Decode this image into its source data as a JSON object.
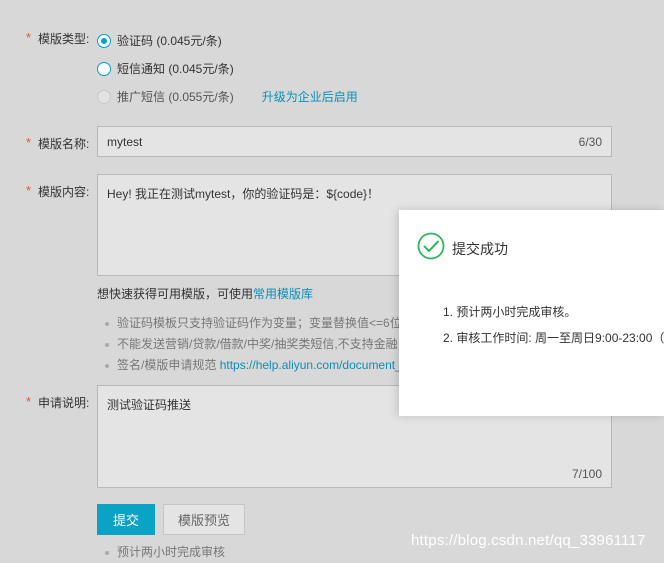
{
  "form": {
    "template_type": {
      "required_mark": "*",
      "label": "模版类型:",
      "options": [
        {
          "label": "验证码 (0.045元/条)",
          "checked": true,
          "disabled": false
        },
        {
          "label": "短信通知 (0.045元/条)",
          "checked": false,
          "disabled": false
        },
        {
          "label": "推广短信 (0.055元/条)",
          "checked": false,
          "disabled": true
        }
      ],
      "upgrade_link": "升级为企业后启用"
    },
    "template_name": {
      "required_mark": "*",
      "label": "模版名称:",
      "value": "mytest",
      "counter": "6/30"
    },
    "template_content": {
      "required_mark": "*",
      "label": "模版内容:",
      "value": "Hey! 我正在测试mytest，你的验证码是：${code}！",
      "hint_prefix": "想快速获得可用模版，可使用",
      "hint_link": "常用模版库",
      "rules": [
        "验证码模板只支持验证码作为变量；变量替换值<=6位",
        "不能发送营销/贷款/借款/中奖/抽奖类短信,不支持金融",
        "签名/模版申请规范"
      ],
      "rules_link": "https://help.aliyun.com/document_"
    },
    "apply_note": {
      "required_mark": "*",
      "label": "申请说明:",
      "value": "测试验证码推送",
      "counter": "7/100"
    },
    "submit_label": "提交",
    "preview_label": "模版预览",
    "footer_note": "预计两小时完成审核"
  },
  "dialog": {
    "title": "提交成功",
    "icon": "check-circle-icon",
    "items": [
      "1. 预计两小时完成审核。",
      "2. 审核工作时间: 周一至周日9:00-23:00（"
    ]
  },
  "watermark": "https://blog.csdn.net/qq_33961117",
  "colors": {
    "accent": "#0aa3c6",
    "required": "#e0542b",
    "success": "#2eb85c"
  }
}
